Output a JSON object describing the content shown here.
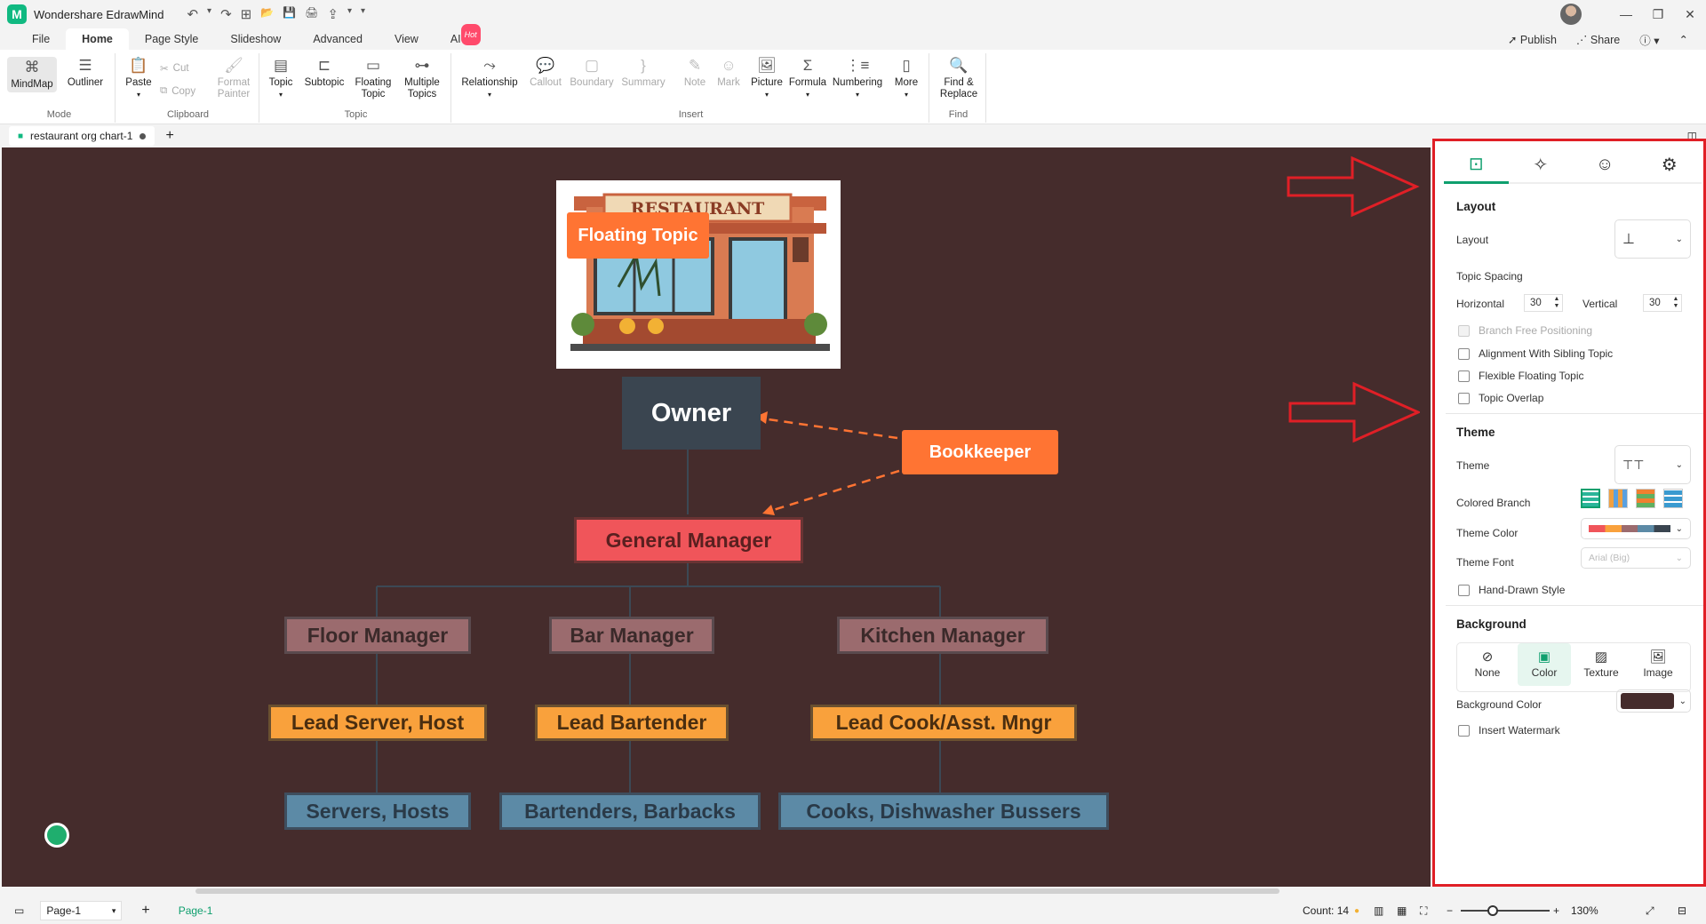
{
  "app": {
    "title": "Wondershare EdrawMind",
    "logo_letter": "M"
  },
  "quick_access": [
    "↶",
    "▾",
    "↷",
    "⊞",
    "📂",
    "💾",
    "🖨",
    "⇪",
    "▾",
    "▾"
  ],
  "menu": {
    "tabs": [
      "File",
      "Home",
      "Page Style",
      "Slideshow",
      "Advanced",
      "View",
      "AI"
    ],
    "hot_badge": "Hot",
    "publish": "Publish",
    "share": "Share",
    "help": "?"
  },
  "ribbon": {
    "mode": {
      "label": "Mode",
      "mindmap": "MindMap",
      "outliner": "Outliner"
    },
    "clipboard": {
      "label": "Clipboard",
      "paste": "Paste",
      "cut": "Cut",
      "copy": "Copy",
      "format_painter": "Format Painter"
    },
    "topic": {
      "label": "Topic",
      "topic": "Topic",
      "subtopic": "Subtopic",
      "floating_topic": "Floating Topic",
      "multiple_topics": "Multiple Topics"
    },
    "insert": {
      "label": "Insert",
      "relationship": "Relationship",
      "callout": "Callout",
      "boundary": "Boundary",
      "summary": "Summary",
      "note": "Note",
      "mark": "Mark",
      "picture": "Picture",
      "formula": "Formula",
      "numbering": "Numbering",
      "more": "More"
    },
    "find": {
      "label": "Find",
      "find_replace": "Find & Replace"
    }
  },
  "document": {
    "tab_name": "restaurant org chart-1",
    "add": "+"
  },
  "chart": {
    "image_sign": "RESTAURANT",
    "floating_topic": "Floating Topic",
    "owner": "Owner",
    "bookkeeper": "Bookkeeper",
    "general_manager": "General Manager",
    "managers": [
      "Floor Manager",
      "Bar Manager",
      "Kitchen Manager"
    ],
    "leads": [
      "Lead Server, Host",
      "Lead Bartender",
      "Lead Cook/Asst. Mngr"
    ],
    "staff": [
      "Servers, Hosts",
      "Bartenders, Barbacks",
      "Cooks, Dishwasher Bussers"
    ],
    "colors": {
      "background": "#452c2c",
      "orange": "#ff7433",
      "owner": "#3a4550",
      "gm": "#f0555a",
      "manager": "#9b6b6e",
      "lead": "#f9a13c",
      "staff": "#5c8aa6"
    }
  },
  "panel": {
    "layout_heading": "Layout",
    "layout_label": "Layout",
    "topic_spacing": "Topic Spacing",
    "horizontal_label": "Horizontal",
    "horizontal_value": "30",
    "vertical_label": "Vertical",
    "vertical_value": "30",
    "branch_free": "Branch Free Positioning",
    "alignment": "Alignment With Sibling Topic",
    "flexible": "Flexible Floating Topic",
    "overlap": "Topic Overlap",
    "theme_heading": "Theme",
    "theme_label": "Theme",
    "colored_branch": "Colored Branch",
    "theme_color": "Theme Color",
    "theme_font": "Theme Font",
    "theme_font_value": "Arial (Big)",
    "hand_drawn": "Hand-Drawn Style",
    "background_heading": "Background",
    "bg_options": [
      "None",
      "Color",
      "Texture",
      "Image"
    ],
    "background_color_label": "Background Color",
    "background_color_value": "#452c2c",
    "watermark": "Insert Watermark",
    "accent": "#0f9f6e"
  },
  "status": {
    "page_select": "Page-1",
    "page_tab": "Page-1",
    "count": "Count: 14",
    "zoom": "130%",
    "minus": "−",
    "plus": "+"
  }
}
